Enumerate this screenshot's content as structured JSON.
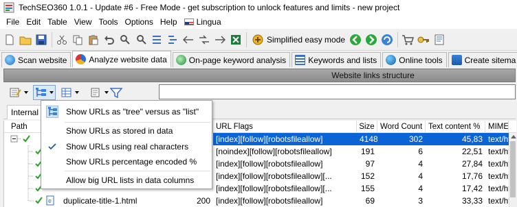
{
  "window": {
    "title": "TechSEO360 1.0.1 - Update #6 - Free Mode - get subscription to unlock features and limits - new project"
  },
  "menu": {
    "items": [
      "File",
      "Edit",
      "Table",
      "View",
      "Tools",
      "Options",
      "Help"
    ],
    "lingua": "Lingua"
  },
  "toolbar": {
    "simplified_label": "Simplified easy mode"
  },
  "tabs": [
    {
      "label": "Scan website"
    },
    {
      "label": "Analyze website data"
    },
    {
      "label": "On-page keyword analysis"
    },
    {
      "label": "Keywords and lists"
    },
    {
      "label": "Online tools"
    },
    {
      "label": "Create sitema"
    }
  ],
  "section": {
    "title": "Website links structure"
  },
  "subtab": {
    "label": "Internal"
  },
  "grid": {
    "headers": {
      "path": "Path",
      "url_flags": "URL Flags",
      "size": "Size",
      "word_count": "Word Count",
      "text_content": "Text content %",
      "mime": "MIME"
    },
    "rows": [
      {
        "path": "",
        "code": "",
        "flags": "[index][follow][robotsfileallow]",
        "size": "4148",
        "words": "302",
        "text": "45,83",
        "mime": "text/htm"
      },
      {
        "path": "",
        "code": "",
        "flags": "[noindex][follow][robotsfileallow]",
        "size": "191",
        "words": "6",
        "text": "22,51",
        "mime": "text/htm"
      },
      {
        "path": "",
        "code": "",
        "flags": "[index][follow][robotsfileallow]",
        "size": "97",
        "words": "4",
        "text": "27,84",
        "mime": "text/htm"
      },
      {
        "path": "",
        "code": "",
        "flags": "[index][follow][robotsfileallow][...",
        "size": "152",
        "words": "4",
        "text": "17,76",
        "mime": "text/htm"
      },
      {
        "path": "",
        "code": "",
        "flags": "[index][follow][robotsfileallow][...",
        "size": "155",
        "words": "4",
        "text": "17,42",
        "mime": "text/htm"
      },
      {
        "path": "duplicate-title-1.html",
        "code": "200",
        "flags": "[index][follow][robotsfileallow]",
        "size": "69",
        "words": "3",
        "text": "33,33",
        "mime": "text/htm"
      }
    ]
  },
  "dropdown": {
    "items": [
      {
        "label": "Show URLs as \"tree\" versus as \"list\"",
        "checked": false,
        "icon": true
      },
      {
        "label": "Show URLs as stored in data",
        "checked": false,
        "icon": false
      },
      {
        "label": "Show URLs using real characters",
        "checked": true,
        "icon": false
      },
      {
        "label": "Show URLs percentage encoded %",
        "checked": false,
        "icon": false
      },
      {
        "label": "Allow big URL lists in data columns",
        "checked": false,
        "icon": false
      }
    ]
  },
  "colors": {
    "selection": "#0a64d6",
    "header_bar": "#999999",
    "check_green": "#2a9d2a"
  }
}
